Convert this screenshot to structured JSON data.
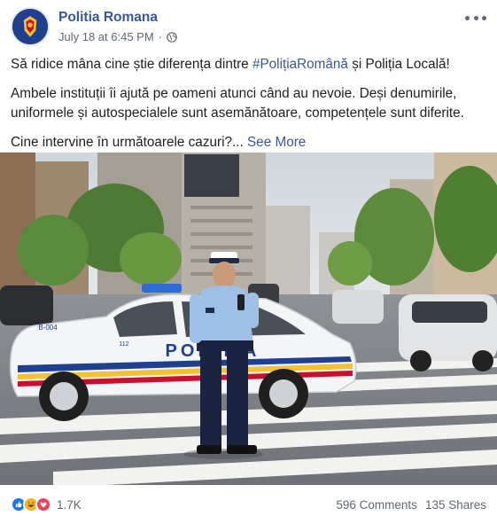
{
  "post": {
    "page_name": "Politia Romana",
    "timestamp": "July 18 at 6:45 PM",
    "separator": "·",
    "privacy_icon": "globe-icon",
    "more_icon": "more-options-icon",
    "text": {
      "line1_before": "Să ridice mâna cine știe diferența dintre ",
      "line1_hashtag": "#PolițiaRomână",
      "line1_after": " și Poliția Locală!",
      "paragraph2": "Ambele instituții îi ajută pe oameni atunci când au nevoie. Deși denumirile, uniformele și autospecialele sunt asemănătoare, competențele sunt diferite.",
      "paragraph3": "Cine intervine în următoarele cazuri?...",
      "see_more": "See More"
    },
    "photo": {
      "car_lettering": "POLITIA",
      "car_plate": "B-004",
      "car_number": "112"
    },
    "footer": {
      "reactions": [
        "like-icon",
        "haha-icon",
        "love-icon"
      ],
      "reaction_count": "1.7K",
      "comments": "596 Comments",
      "shares": "135 Shares"
    }
  },
  "colors": {
    "link_blue": "#385898",
    "meta_gray": "#606770",
    "like_blue": "#1877f2",
    "haha_yellow": "#f7b125",
    "love_red": "#f33e58"
  }
}
